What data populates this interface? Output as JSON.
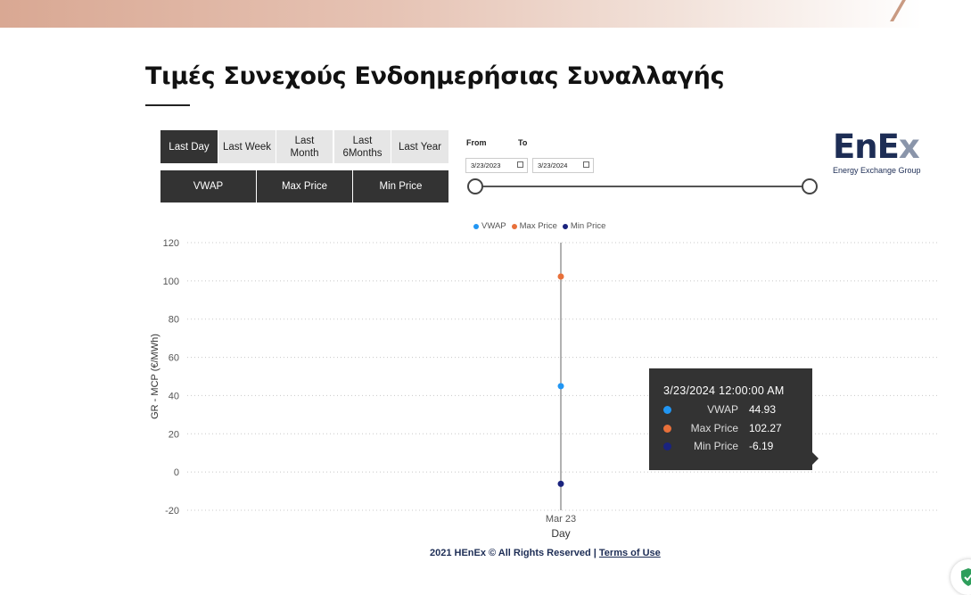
{
  "page": {
    "title": "Τιμές Συνεχούς Ενδοημερήσιας Συναλλαγής"
  },
  "period_buttons": [
    {
      "label": "Last Day",
      "active": true
    },
    {
      "label": "Last Week",
      "active": false
    },
    {
      "label": "Last Month",
      "active": false
    },
    {
      "label": "Last 6Months",
      "active": false
    },
    {
      "label": "Last Year",
      "active": false
    }
  ],
  "metric_buttons": [
    "VWAP",
    "Max Price",
    "Min Price"
  ],
  "date_range": {
    "from_label": "From",
    "to_label": "To",
    "from_value": "3/23/2023",
    "to_value": "3/23/2024"
  },
  "logo": {
    "text_main": "EnE",
    "text_x": "x",
    "subtitle": "Energy Exchange Group"
  },
  "colors": {
    "vwap": "#2196f3",
    "max_price": "#e8703a",
    "min_price": "#1a237e",
    "dark_button": "#333333",
    "brand": "#1d2d55"
  },
  "chart_data": {
    "type": "scatter",
    "xlabel": "Day",
    "ylabel": "GR - MCP (€/MWh)",
    "ylim": [
      -20,
      120
    ],
    "yticks": [
      120,
      100,
      80,
      60,
      40,
      20,
      0,
      -20
    ],
    "categories": [
      "Mar 23"
    ],
    "grid": true,
    "legend_position": "top",
    "series": [
      {
        "name": "VWAP",
        "values": [
          44.93
        ]
      },
      {
        "name": "Max Price",
        "values": [
          102.27
        ]
      },
      {
        "name": "Min Price",
        "values": [
          -6.19
        ]
      }
    ]
  },
  "tooltip": {
    "date": "3/23/2024 12:00:00 AM",
    "rows": [
      {
        "name": "VWAP",
        "value": "44.93"
      },
      {
        "name": "Max Price",
        "value": "102.27"
      },
      {
        "name": "Min Price",
        "value": "-6.19"
      }
    ]
  },
  "footer": {
    "copyright": "2021 HEnEx © All Rights Reserved | ",
    "terms_link": "Terms of Use"
  }
}
